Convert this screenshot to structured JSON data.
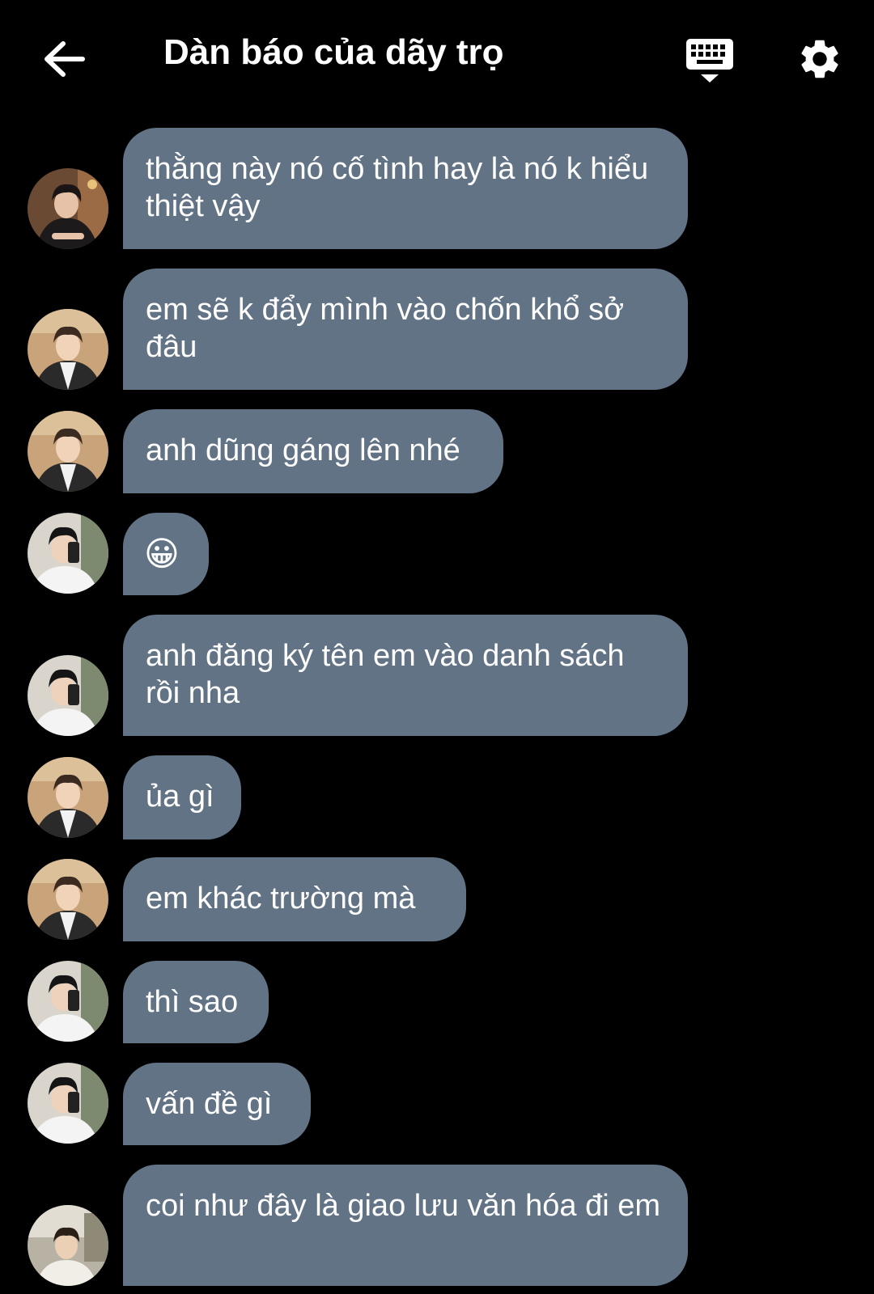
{
  "header": {
    "title": "Dàn báo của dãy trọ",
    "back_icon": "arrow-left-icon",
    "keyboard_icon": "keyboard-icon",
    "settings_icon": "gear-icon"
  },
  "colors": {
    "background": "#000000",
    "bubble": "#627386",
    "text": "#ffffff"
  },
  "messages": [
    {
      "avatar": "avatar-1",
      "text": "thằng này nó cố tình hay là nó k hiểu thiệt vậy"
    },
    {
      "avatar": "avatar-2",
      "text": "em sẽ k đẩy mình vào chốn khổ sở đâu"
    },
    {
      "avatar": "avatar-2",
      "text": "anh dũng gáng lên nhé"
    },
    {
      "avatar": "avatar-3",
      "text": "😀"
    },
    {
      "avatar": "avatar-3",
      "text": "anh đăng ký tên em vào danh sách rồi nha"
    },
    {
      "avatar": "avatar-2",
      "text": "ủa gì"
    },
    {
      "avatar": "avatar-2",
      "text": "em khác trường mà"
    },
    {
      "avatar": "avatar-3",
      "text": "thì sao"
    },
    {
      "avatar": "avatar-3",
      "text": "vấn đề gì"
    },
    {
      "avatar": "avatar-4",
      "text": "coi như đây là giao lưu văn hóa đi em"
    }
  ]
}
